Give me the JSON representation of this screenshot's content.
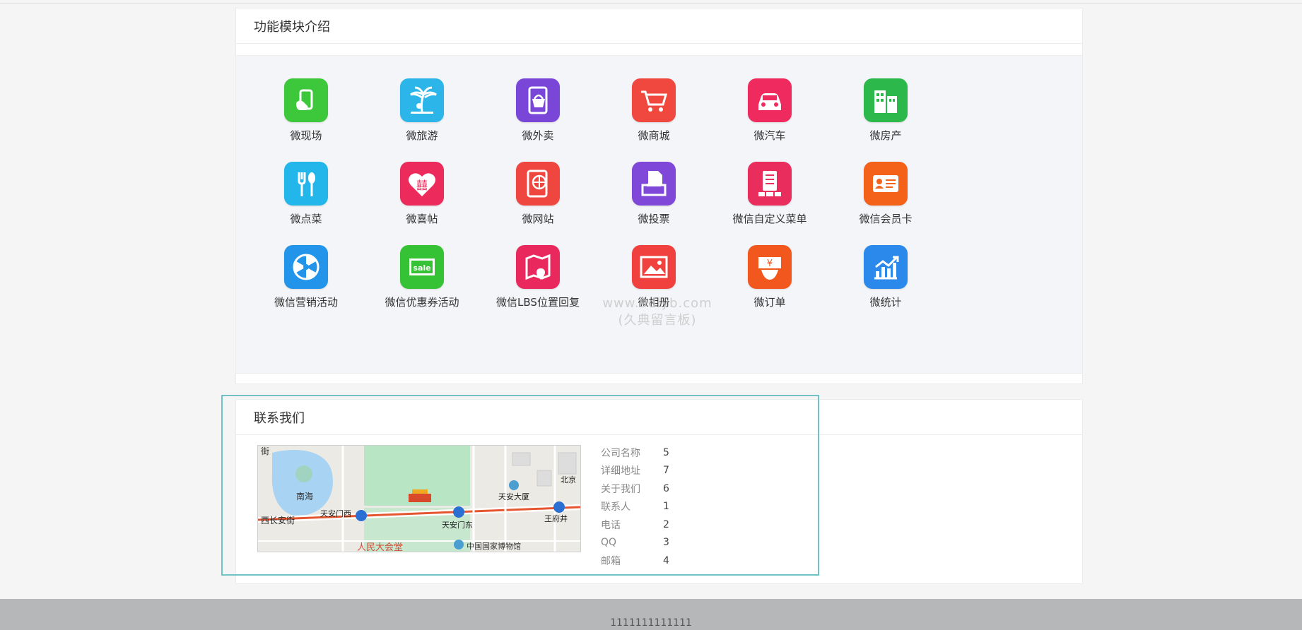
{
  "modules_section": {
    "title": "功能模块介绍",
    "items": [
      {
        "label": "微现场",
        "icon": "hand-phone-icon",
        "color": "#3cc83a"
      },
      {
        "label": "微旅游",
        "icon": "palm-tree-icon",
        "color": "#2bb5e8"
      },
      {
        "label": "微外卖",
        "icon": "shopping-basket-icon",
        "color": "#7a46d8"
      },
      {
        "label": "微商城",
        "icon": "shopping-cart-icon",
        "color": "#f0473e"
      },
      {
        "label": "微汽车",
        "icon": "car-icon",
        "color": "#ef2a5f"
      },
      {
        "label": "微房产",
        "icon": "buildings-icon",
        "color": "#2cb84a"
      },
      {
        "label": "微点菜",
        "icon": "fork-spoon-icon",
        "color": "#22b6ea"
      },
      {
        "label": "微喜帖",
        "icon": "heart-xi-icon",
        "color": "#ec2a5b"
      },
      {
        "label": "微网站",
        "icon": "globe-tablet-icon",
        "color": "#ef473f"
      },
      {
        "label": "微投票",
        "icon": "ballot-box-icon",
        "color": "#7f48d9"
      },
      {
        "label": "微信自定义菜单",
        "icon": "menu-list-icon",
        "color": "#e92e5e"
      },
      {
        "label": "微信会员卡",
        "icon": "member-card-icon",
        "color": "#f46119"
      },
      {
        "label": "微信营销活动",
        "icon": "lottery-wheel-icon",
        "color": "#2295ea"
      },
      {
        "label": "微信优惠券活动",
        "icon": "sale-coupon-icon",
        "color": "#35c234"
      },
      {
        "label": "微信LBS位置回复",
        "icon": "map-pin-icon",
        "color": "#e9295d"
      },
      {
        "label": "微相册",
        "icon": "photo-icon",
        "color": "#f0413e"
      },
      {
        "label": "微订单",
        "icon": "yen-hand-icon",
        "color": "#f2581e"
      },
      {
        "label": "微统计",
        "icon": "chart-up-icon",
        "color": "#2a89ea"
      }
    ]
  },
  "watermark": {
    "line1": "www.9dlyb.com",
    "line2": "(久典留言板)"
  },
  "contact_section": {
    "title": "联系我们",
    "map": {
      "labels": {
        "street_top": "街",
        "nanhai": "南海",
        "xichangan": "西长安街",
        "tiananmen_west": "天安门西",
        "tiananmen_east": "天安门东",
        "tianan_building": "天安大厦",
        "beijing": "北京",
        "wangfujing": "王府井",
        "great_hall": "人民大会堂",
        "museum": "中国国家博物馆"
      }
    },
    "fields": [
      {
        "key": "公司名称",
        "value": "5"
      },
      {
        "key": "详细地址",
        "value": "7"
      },
      {
        "key": "关于我们",
        "value": "6"
      },
      {
        "key": "联系人",
        "value": "1"
      },
      {
        "key": "电话",
        "value": "2"
      },
      {
        "key": "QQ",
        "value": "3"
      },
      {
        "key": "邮箱",
        "value": "4"
      }
    ]
  },
  "footer": {
    "text": "1111111111111"
  }
}
